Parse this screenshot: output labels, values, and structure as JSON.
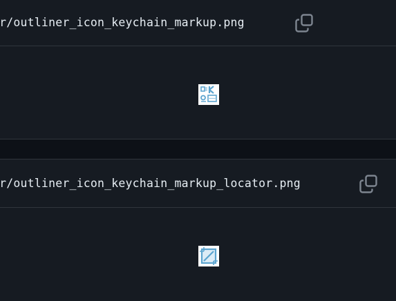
{
  "files": [
    {
      "path": "or/outliner_icon_keychain_markup.png",
      "copy_icon": "copy-icon",
      "preview_icon": "keychain-markup-icon"
    },
    {
      "path": "or/outliner_icon_keychain_markup_locator.png",
      "copy_icon": "copy-icon",
      "preview_icon": "keychain-markup-locator-icon"
    }
  ],
  "colors": {
    "page_bg": "#0d1117",
    "block_bg": "#161b22",
    "border": "#30363d",
    "text": "#e6edf3",
    "icon": "#7d8590",
    "preview_accent": "#5ba4cf"
  }
}
